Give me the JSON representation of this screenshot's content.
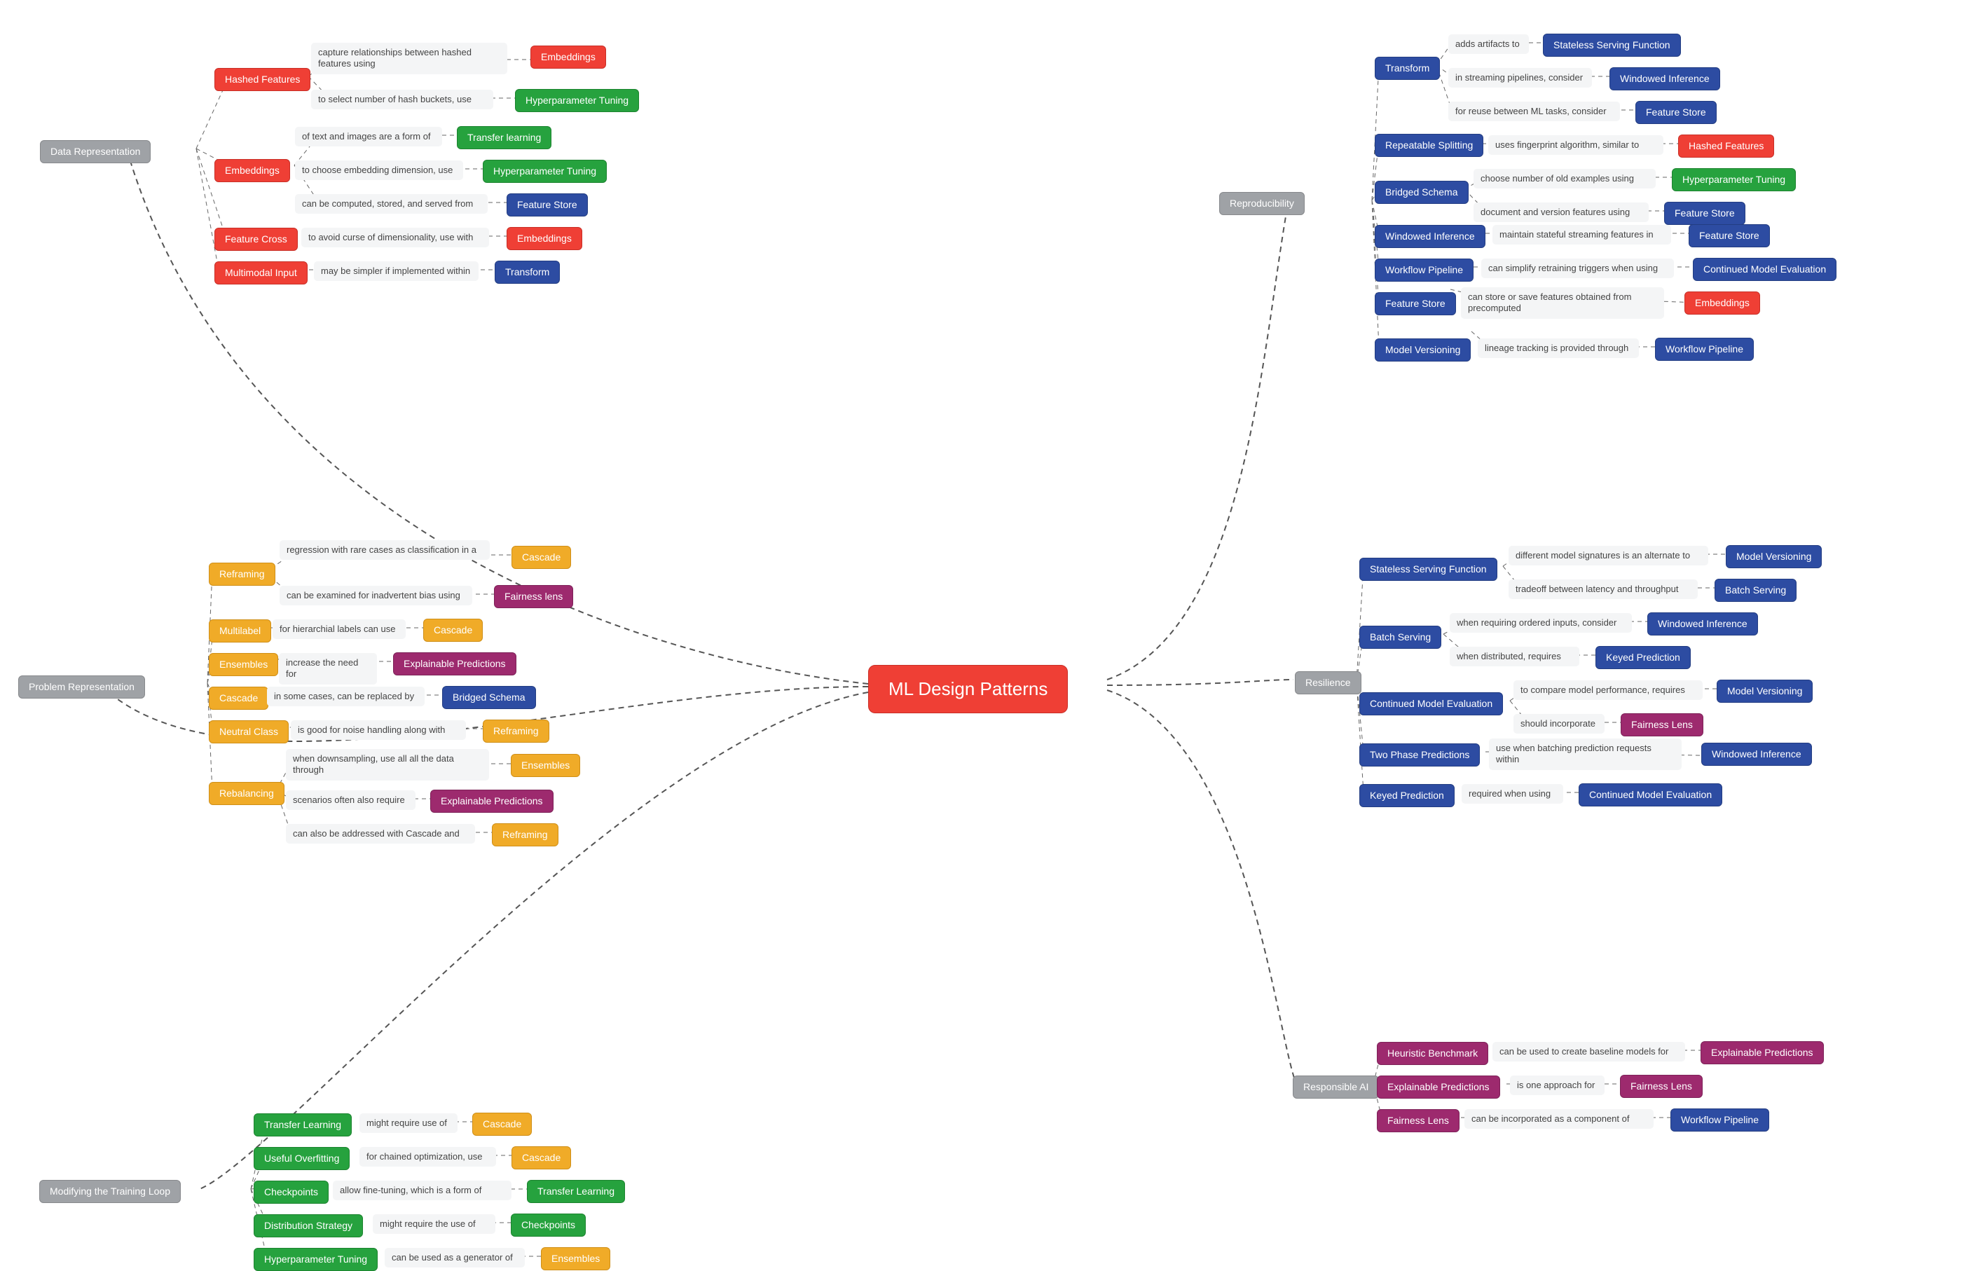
{
  "center": "ML Design Patterns",
  "categories": {
    "data_rep": "Data Representation",
    "problem_rep": "Problem Representation",
    "train_loop": "Modifying the Training Loop",
    "reproducibility": "Reproducibility",
    "resilience": "Resilience",
    "responsible_ai": "Responsible AI"
  },
  "patterns": {
    "hashed_features": "Hashed Features",
    "embeddings": "Embeddings",
    "feature_cross": "Feature Cross",
    "multimodal_input": "Multimodal Input",
    "hyperparameter_tuning": "Hyperparameter Tuning",
    "transfer_learning": "Transfer learning",
    "transfer_learning_cap": "Transfer Learning",
    "feature_store": "Feature Store",
    "transform": "Transform",
    "reframing": "Reframing",
    "multilabel": "Multilabel",
    "ensembles": "Ensembles",
    "cascade": "Cascade",
    "neutral_class": "Neutral Class",
    "rebalancing": "Rebalancing",
    "fairness_lens": "Fairness lens",
    "fairness_lens_cap": "Fairness Lens",
    "explainable_predictions": "Explainable Predictions",
    "bridged_schema": "Bridged Schema",
    "useful_overfitting": "Useful Overfitting",
    "checkpoints": "Checkpoints",
    "distribution_strategy": "Distribution Strategy",
    "repeatable_splitting": "Repeatable Splitting",
    "stateless_serving_function": "Stateless Serving Function",
    "windowed_inference": "Windowed Inference",
    "workflow_pipeline": "Workflow Pipeline",
    "continued_model_evaluation": "Continued Model Evaluation",
    "model_versioning": "Model Versioning",
    "batch_serving": "Batch Serving",
    "keyed_prediction": "Keyed Prediction",
    "two_phase_predictions": "Two Phase Predictions",
    "heuristic_benchmark": "Heuristic Benchmark"
  },
  "descriptions": {
    "dr_hashed_1": "capture relationships between hashed features using",
    "dr_hashed_2": "to select number of hash buckets, use",
    "dr_emb_1": "of text and images are a form of",
    "dr_emb_2": "to choose embedding dimension, use",
    "dr_emb_3": "can be computed, stored, and served from",
    "dr_fc_1": "to avoid curse of dimensionality, use with",
    "dr_mi_1": "may be simpler if implemented within",
    "pr_rf_1": "regression with rare cases as classification in a",
    "pr_rf_2": "can be examined for inadvertent bias using",
    "pr_ml_1": "for hierarchial labels can use",
    "pr_en_1": "increase the need for",
    "pr_cs_1": "in some cases, can be replaced by",
    "pr_nc_1": "is good for noise handling along with",
    "pr_rb_1": "when downsampling, use all all the data through",
    "pr_rb_2": "scenarios often also require",
    "pr_rb_3": "can also be addressed with Cascade and",
    "tl_tf_1": "might require use of",
    "tl_uo_1": "for chained optimization, use",
    "tl_cp_1": "allow fine-tuning, which is a form of",
    "tl_ds_1": "might require the use of",
    "tl_ht_1": "can be used as a generator of",
    "rp_tf_1": "adds artifacts to",
    "rp_tf_2": "in streaming pipelines, consider",
    "rp_tf_3": "for reuse between ML tasks, consider",
    "rp_rs_1": "uses fingerprint algorithm, similar to",
    "rp_bs_1": "choose number of old examples using",
    "rp_bs_2": "document and version features using",
    "rp_wi_1": "maintain stateful streaming features in",
    "rp_wp_1": "can simplify retraining triggers when using",
    "rp_fs_1": "can store or save features obtained from precomputed",
    "rp_mv_1": "lineage tracking is provided through",
    "rs_ss_1": "different model signatures is an alternate to",
    "rs_ss_2": "tradeoff between latency and throughput",
    "rs_bs_1": "when requiring ordered inputs, consider",
    "rs_bs_2": "when distributed, requires",
    "rs_cme_1": "to compare model performance, requires",
    "rs_cme_2": "should incorporate",
    "rs_tp_1": "use when batching prediction requests within",
    "rs_kp_1": "required when using",
    "ra_hb_1": "can be used to create baseline models for",
    "ra_ep_1": "is one approach for",
    "ra_fl_1": "can be incorporated as a component of"
  }
}
